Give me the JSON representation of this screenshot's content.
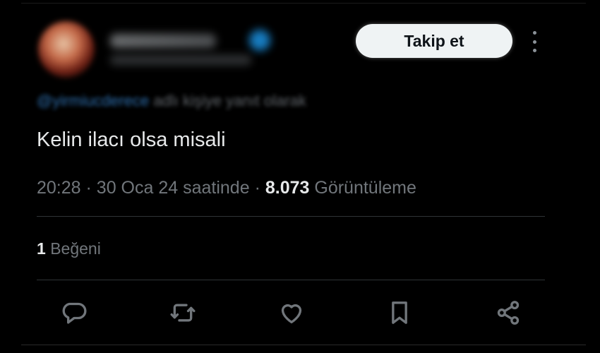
{
  "header": {
    "follow_label": "Takip et"
  },
  "reply": {
    "handle": "@yirmiucderece",
    "suffix": "adlı kişiye yanıt olarak"
  },
  "tweet": {
    "text": "Kelin ilacı olsa misali"
  },
  "meta": {
    "time": "20:28",
    "separator": "·",
    "date": "30 Oca 24 saatinde",
    "views_count": "8.073",
    "views_label": "Görüntüleme"
  },
  "likes": {
    "count": "1",
    "label": "Beğeni"
  },
  "actions": {
    "reply_icon": "reply-icon",
    "repost_icon": "repost-icon",
    "like_icon": "heart-icon",
    "bookmark_icon": "bookmark-icon",
    "share_icon": "share-icon",
    "icon_color": "#71767b"
  },
  "colors": {
    "background": "#000000",
    "text": "#e7e9ea",
    "muted": "#71767b",
    "link": "#1d9bf0",
    "button_bg": "#eff3f4"
  }
}
